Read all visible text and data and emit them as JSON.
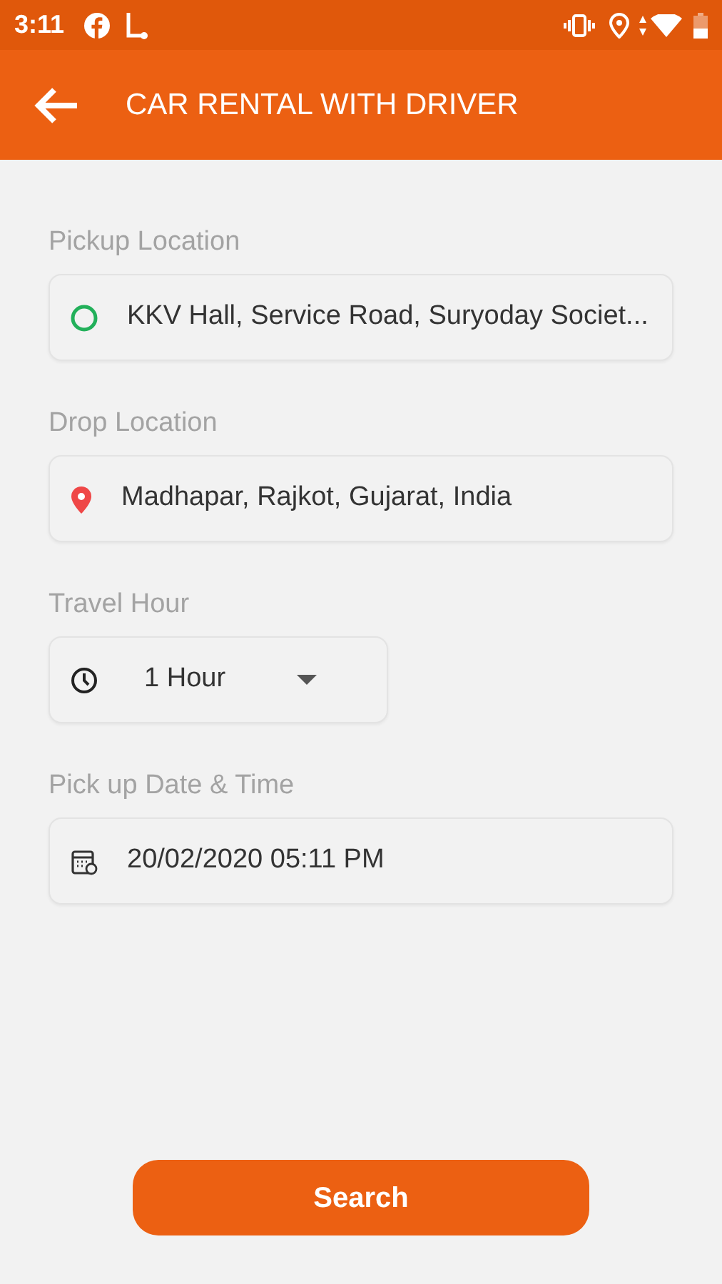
{
  "status_bar": {
    "time": "3:11"
  },
  "app_bar": {
    "title": "CAR RENTAL WITH DRIVER"
  },
  "fields": [
    {
      "kind": "pickup",
      "label": "Pickup Location",
      "value": "KKV Hall, Service Road, Suryoday Societ..."
    },
    {
      "kind": "drop",
      "label": "Drop Location",
      "value": "Madhapar, Rajkot, Gujarat, India"
    },
    {
      "kind": "hour",
      "label": "Travel Hour",
      "value": "1 Hour"
    },
    {
      "kind": "datetime",
      "label": "Pick up Date & Time",
      "value": "20/02/2020 05:11 PM"
    }
  ],
  "search_button": "Search"
}
